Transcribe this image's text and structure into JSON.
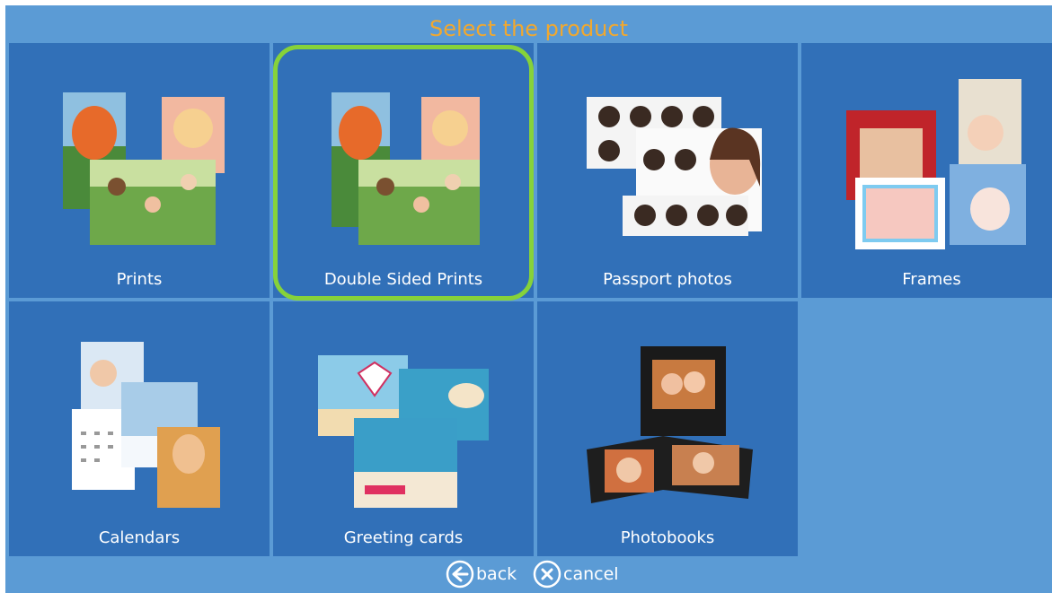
{
  "header": {
    "title": "Select the product"
  },
  "products": [
    {
      "label": "Prints",
      "icon": "prints-collage-icon"
    },
    {
      "label": "Double Sided Prints",
      "icon": "double-sided-prints-icon"
    },
    {
      "label": "Passport photos",
      "icon": "passport-photos-icon"
    },
    {
      "label": "Frames",
      "icon": "frames-icon"
    },
    {
      "label": "Calendars",
      "icon": "calendar-icon"
    },
    {
      "label": "Greeting cards",
      "icon": "greeting-cards-icon"
    },
    {
      "label": "Photobooks",
      "icon": "photobook-icon"
    }
  ],
  "selected": "Double Sided Prints",
  "footer": {
    "back_label": "back",
    "cancel_label": "cancel"
  },
  "colors": {
    "background": "#5b9bd5",
    "tile": "#3170b8",
    "title": "#f0a830",
    "highlight": "#86d23a"
  }
}
